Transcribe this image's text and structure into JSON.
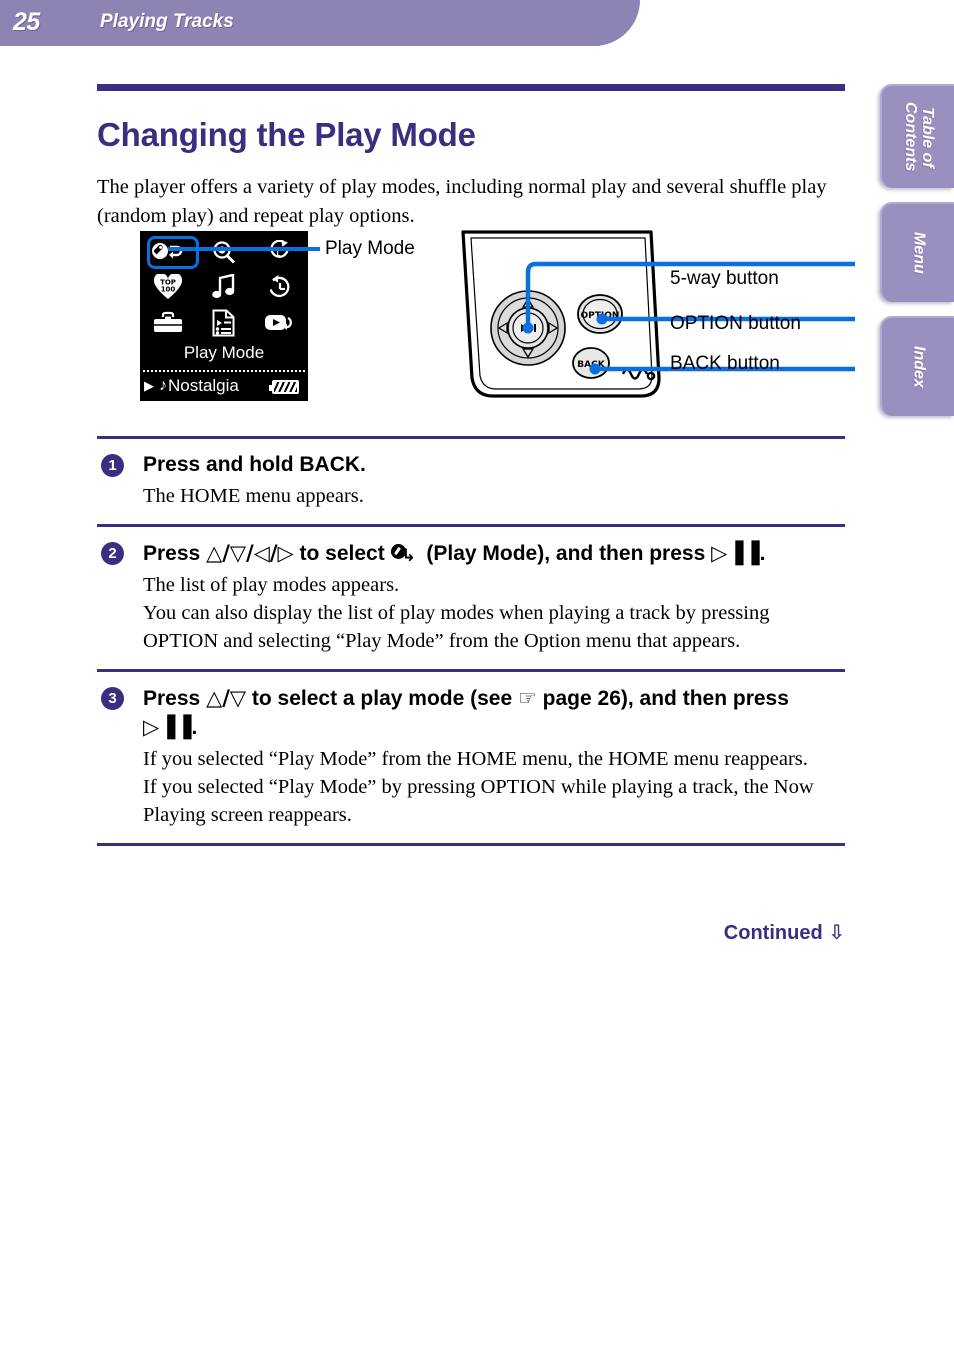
{
  "header": {
    "page_number": "25",
    "chapter_title": "Playing Tracks",
    "bar_color": "#8e84b4"
  },
  "side_tabs": [
    {
      "label": "Table of Contents",
      "name": "table-of-contents"
    },
    {
      "label": "Menu",
      "name": "menu"
    },
    {
      "label": "Index",
      "name": "index"
    }
  ],
  "title": {
    "heading": "Changing the Play Mode",
    "rule_color": "#3b2d80"
  },
  "intro": "The player offers a variety of play modes, including normal play and several shuffle play (random play) and repeat play options.",
  "figure_lcd": {
    "caption": "Play Mode",
    "status_play_icon": "▶",
    "status_note_icon": "♪",
    "status_track": "Nostalgia",
    "callout_label": "Play Mode",
    "callout_color": "#0a6fe0",
    "icons": [
      {
        "name": "play-mode-icon",
        "selected": true
      },
      {
        "name": "search-icon",
        "selected": false
      },
      {
        "name": "shuffle-repeat-icon",
        "selected": false
      },
      {
        "name": "top-100-heart-icon",
        "selected": false
      },
      {
        "name": "music-note-icon",
        "selected": false
      },
      {
        "name": "recent-clock-icon",
        "selected": false
      },
      {
        "name": "toolbox-icon",
        "selected": false
      },
      {
        "name": "playlist-icon",
        "selected": false
      },
      {
        "name": "intro-scan-icon",
        "selected": false
      }
    ]
  },
  "figure_device": {
    "option_button_label": "OPTION",
    "back_button_label": "BACK",
    "center_button_label": "▷▐▐",
    "callouts": [
      {
        "label": "5-way button"
      },
      {
        "label": "OPTION button"
      },
      {
        "label": "BACK button"
      }
    ],
    "line_color": "#0a6fe0"
  },
  "steps": [
    {
      "number": "1",
      "heading_parts": [
        {
          "t": "text",
          "v": "Press and hold BACK."
        }
      ],
      "lines": [
        "The HOME menu appears."
      ]
    },
    {
      "number": "2",
      "heading_parts": [
        {
          "t": "text",
          "v": "Press "
        },
        {
          "t": "glyph",
          "v": "△/▽/◁/▷"
        },
        {
          "t": "text",
          "v": " to select "
        },
        {
          "t": "playmode",
          "v": ""
        },
        {
          "t": "text",
          "v": " (Play Mode), and then press "
        },
        {
          "t": "glyph",
          "v": "▷▐▐"
        },
        {
          "t": "text",
          "v": "."
        }
      ],
      "lines": [
        "The list of play modes appears.",
        "You can also display the list of play modes when playing a track by pressing OPTION and selecting “Play Mode” from the Option menu that appears."
      ]
    },
    {
      "number": "3",
      "heading_parts": [
        {
          "t": "text",
          "v": "Press "
        },
        {
          "t": "glyph",
          "v": "△/▽"
        },
        {
          "t": "text",
          "v": " to select a play mode (see "
        },
        {
          "t": "glyph",
          "v": "☞"
        },
        {
          "t": "text",
          "v": " page 26), and then press "
        },
        {
          "t": "glyph",
          "v": "▷▐▐"
        },
        {
          "t": "text",
          "v": "."
        }
      ],
      "lines": [
        "If you selected “Play Mode” from the HOME menu, the HOME menu reappears.",
        "If you selected “Play Mode” by pressing OPTION while playing a track, the Now Playing screen reappears."
      ]
    }
  ],
  "footer": {
    "continued_label": "Continued",
    "continued_arrow": "⇩"
  }
}
